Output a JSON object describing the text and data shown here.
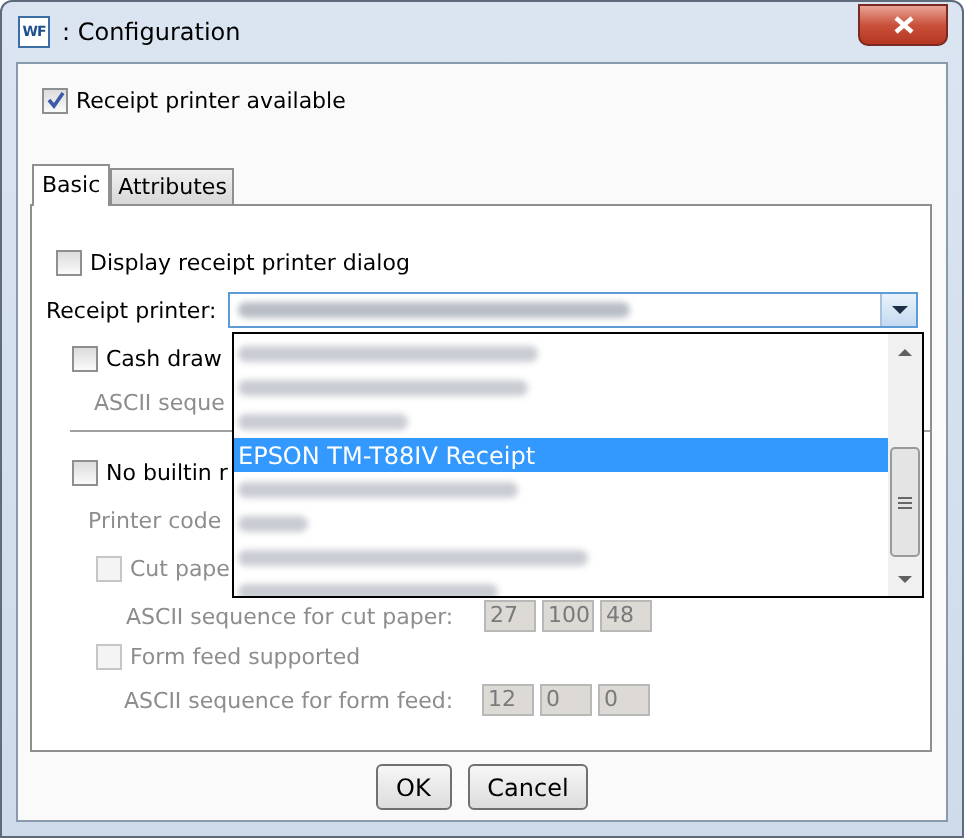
{
  "window": {
    "icon_text": "WF",
    "title": ": Configuration"
  },
  "receipt_printer_available": {
    "label": "Receipt printer available",
    "checked": true
  },
  "tabs": [
    {
      "label": "Basic",
      "selected": true
    },
    {
      "label": "Attributes",
      "selected": false
    }
  ],
  "basic": {
    "display_dialog": {
      "label": "Display receipt printer dialog",
      "checked": false
    },
    "receipt_printer": {
      "label": "Receipt printer:",
      "value": {
        "kind": "blurred"
      },
      "items": [
        {
          "kind": "blurred",
          "selected": false
        },
        {
          "kind": "blurred",
          "selected": false
        },
        {
          "kind": "blurred",
          "selected": false
        },
        {
          "kind": "text",
          "label": "EPSON TM-T88IV Receipt",
          "selected": true
        },
        {
          "kind": "blurred",
          "selected": false
        },
        {
          "kind": "blurred",
          "selected": false
        },
        {
          "kind": "blurred",
          "selected": false
        },
        {
          "kind": "blurred",
          "selected": false
        }
      ]
    },
    "cash_drawer": {
      "label": "Cash draw",
      "checked": false
    },
    "cash_drawer_sequence_label": {
      "label": "ASCII seque",
      "disabled": true
    },
    "no_builtin": {
      "label": "No builtin r",
      "checked": false
    },
    "printer_code_label": {
      "label": "Printer code",
      "disabled": true
    },
    "cut_paper": {
      "label": "Cut pape",
      "checked": false,
      "disabled": true
    },
    "cut_paper_sequence": {
      "label": "ASCII sequence for cut paper:",
      "values": [
        "27",
        "100",
        "48"
      ],
      "disabled": true
    },
    "form_feed": {
      "label": "Form feed supported",
      "checked": false,
      "disabled": true
    },
    "form_feed_sequence": {
      "label": "ASCII sequence for form feed:",
      "values": [
        "12",
        "0",
        "0"
      ],
      "disabled": true
    }
  },
  "buttons": [
    {
      "label": "OK"
    },
    {
      "label": "Cancel"
    }
  ]
}
